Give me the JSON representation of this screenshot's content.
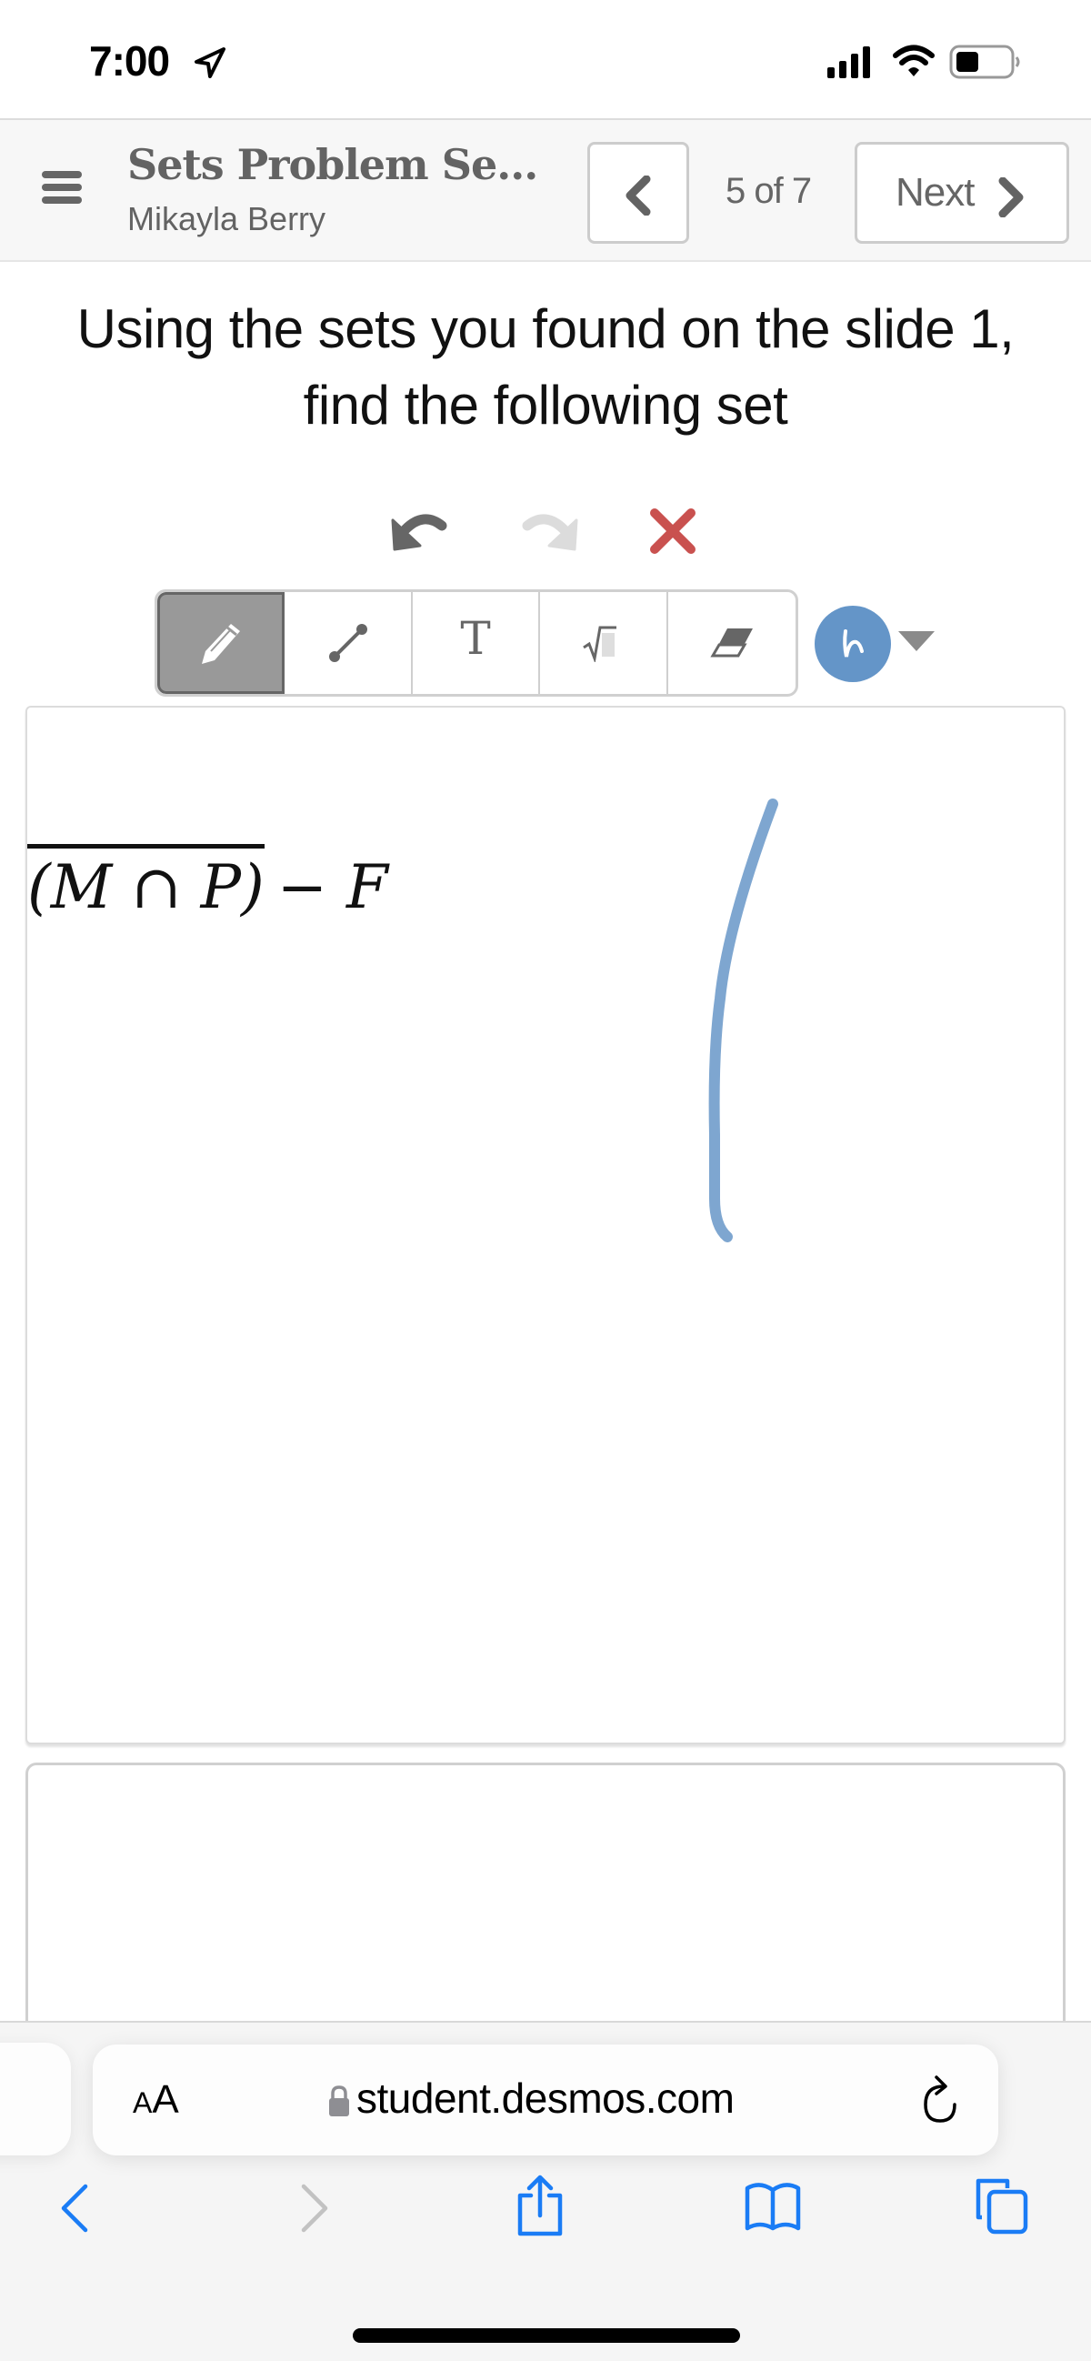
{
  "status_bar": {
    "time": "7:00",
    "icons": [
      "location-arrow-icon",
      "cellular-signal-icon",
      "wifi-icon",
      "battery-icon"
    ]
  },
  "header": {
    "menu_icon": "hamburger-menu-icon",
    "activity_title": "Sets Problem Se...",
    "student_name": "Mikayla Berry",
    "prev_icon": "chevron-left-icon",
    "page_indicator": "5 of 7",
    "next_label": "Next",
    "next_icon": "chevron-right-icon"
  },
  "prompt": {
    "text": "Using the sets you found on the slide 1, find the following set"
  },
  "sketch_controls": {
    "undo_icon": "undo-icon",
    "redo_icon": "redo-icon",
    "redo_enabled": false,
    "clear_icon": "clear-x-icon",
    "clear_color": "#c9514f"
  },
  "toolbar": {
    "tools": [
      {
        "name": "pencil",
        "icon": "pencil-icon",
        "active": true
      },
      {
        "name": "line",
        "icon": "line-segment-icon",
        "active": false
      },
      {
        "name": "text",
        "icon": "text-icon",
        "label": "T",
        "active": false
      },
      {
        "name": "math",
        "icon": "square-root-icon",
        "label": "√",
        "active": false
      },
      {
        "name": "eraser",
        "icon": "eraser-icon",
        "active": false
      }
    ],
    "selected_color": "#6495c8",
    "color_menu_icon": "caret-down-icon"
  },
  "sketch": {
    "expression": {
      "overlined": "(M ∩ P)",
      "tail": " − F"
    },
    "stroke_color": "#7ea6d0"
  },
  "browser": {
    "text_size_label_small": "A",
    "text_size_label_large": "A",
    "url": "student.desmos.com",
    "secure_icon": "lock-icon",
    "reload_icon": "reload-icon",
    "nav": {
      "back_icon": "back-chevron-icon",
      "forward_icon": "forward-chevron-icon",
      "forward_enabled": false,
      "share_icon": "share-icon",
      "bookmarks_icon": "bookmarks-book-icon",
      "tabs_icon": "tabs-icon"
    },
    "accent_color": "#1a7cf5"
  }
}
